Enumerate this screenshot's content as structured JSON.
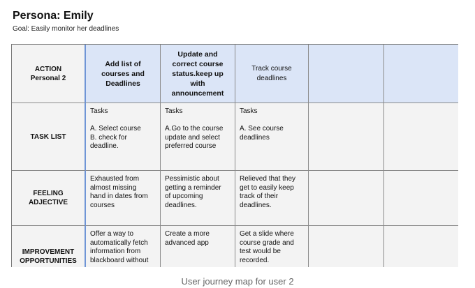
{
  "title": "Persona: Emily",
  "goal": "Goal: Easily monitor her deadlines",
  "table": {
    "header": {
      "action": "ACTION\nPersonal 2",
      "col1": "Add list of courses and Deadlines",
      "col2": "Update and correct course status.keep up with announcement",
      "col3": "Track course deadlines",
      "col4": "",
      "col5": ""
    },
    "rows": [
      {
        "label": "TASK LIST",
        "cells": [
          "Tasks\n\nA. Select course\nB. check for\ndeadline.",
          "Tasks\n\nA.Go to the course\nupdate and select\npreferred course",
          "Tasks\n\nA. See course\ndeadlines",
          "",
          ""
        ]
      },
      {
        "label": "FEELING\nADJECTIVE",
        "cells": [
          "Exhausted from\nalmost missing\nhand in dates from\ncourses",
          "Pessimistic about\ngetting a  reminder\nof upcoming\ndeadlines.",
          "Relieved that they\nget to easily keep\ntrack of their\ndeadlines.",
          "",
          ""
        ]
      },
      {
        "label": "IMPROVEMENT\nOPPORTUNITIES",
        "cells": [
          "Offer a way to\nautomatically fetch\ninformation from\nblackboard without",
          "Create a more\nadvanced app",
          "Get a slide where\ncourse grade and\ntest would be\nrecorded.",
          "",
          ""
        ]
      }
    ]
  },
  "caption": "User journey map for user 2",
  "colors": {
    "header_bg": "#dbe5f7",
    "cell_bg": "#f3f3f3",
    "accent_border": "#6f95d6"
  }
}
